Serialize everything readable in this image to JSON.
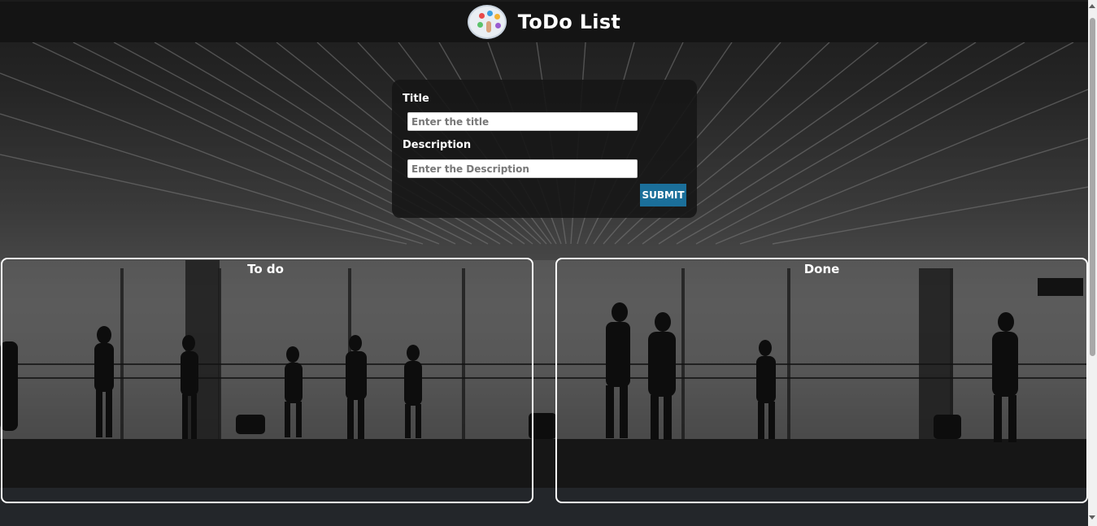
{
  "app": {
    "title": "ToDo List",
    "logo_icon": "todo-app-logo-icon"
  },
  "form": {
    "title_label": "Title",
    "title_placeholder": "Enter the title",
    "title_value": "",
    "description_label": "Description",
    "description_placeholder": "Enter the Description",
    "description_value": "",
    "submit_label": "SUBMIT"
  },
  "panels": {
    "todo_title": "To do",
    "done_title": "Done"
  },
  "colors": {
    "header_bg": "#141414",
    "card_bg": "#161616",
    "submit_bg": "#1b6f9a",
    "panel_border": "#ffffff"
  }
}
